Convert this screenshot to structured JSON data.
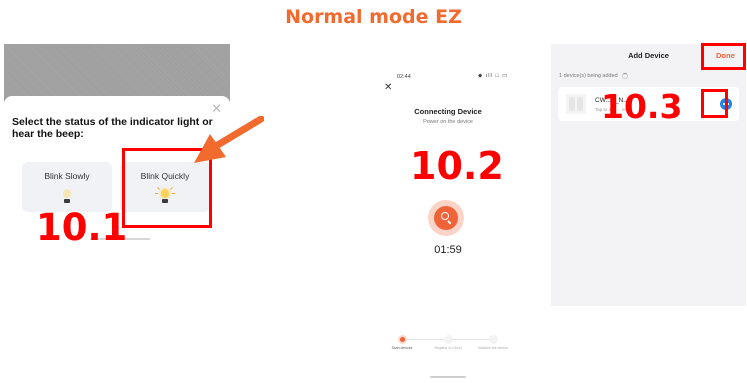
{
  "page": {
    "title": "Normal mode EZ"
  },
  "accent_color": "#f26a2e",
  "annotation_color": "#ff0000",
  "panel1": {
    "question": "Select the status of the indicator light or hear the beep:",
    "close_icon": "close-icon",
    "options": [
      {
        "label": "Blink Slowly",
        "icon": "bulb-icon"
      },
      {
        "label": "Blink Quickly",
        "icon": "bulb-lit-icon"
      }
    ],
    "step_label": "10.1"
  },
  "panel2": {
    "status_time": "02:44",
    "status_icons": "◆ ıll □ ▭",
    "title": "Connecting Device",
    "subtitle": "Power on the device",
    "timer": "01:59",
    "steps": [
      "Scan devices",
      "Register to Cloud",
      "Initialize the device"
    ],
    "step_label": "10.2"
  },
  "panel3": {
    "title": "Add Device",
    "done_label": "Done",
    "count_text": "1 device(s) being added",
    "device": {
      "name": "CW...T_N...Z",
      "subtitle": "Tap to add ... le"
    },
    "step_label": "10.3"
  }
}
